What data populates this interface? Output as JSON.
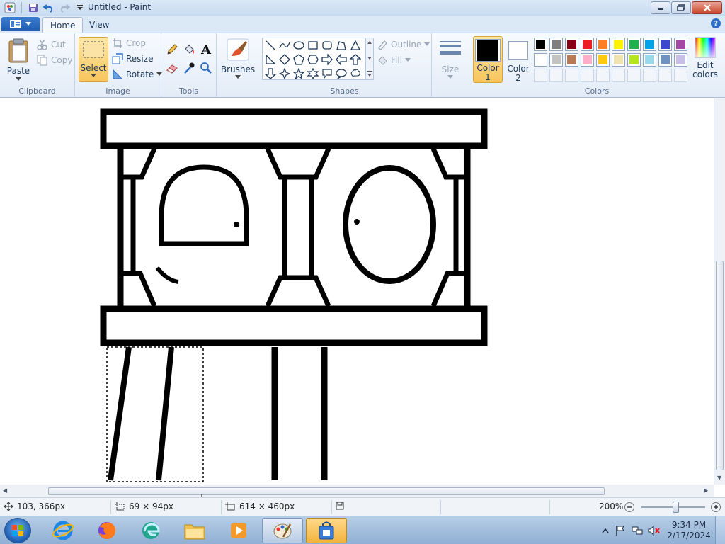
{
  "window": {
    "title": "Untitled - Paint"
  },
  "tabs": [
    {
      "label": "Home",
      "active": true
    },
    {
      "label": "View",
      "active": false
    }
  ],
  "ribbon": {
    "clipboard": {
      "label": "Clipboard",
      "paste": "Paste",
      "cut": "Cut",
      "copy": "Copy"
    },
    "image": {
      "label": "Image",
      "select": "Select",
      "crop": "Crop",
      "resize": "Resize",
      "rotate": "Rotate"
    },
    "tools": {
      "label": "Tools",
      "text_glyph": "A"
    },
    "brushes": {
      "label": "Brushes"
    },
    "shapes": {
      "label": "Shapes",
      "outline": "Outline",
      "fill": "Fill"
    },
    "size": {
      "label": "Size"
    },
    "colors": {
      "label": "Colors",
      "color1": "Color\n1",
      "color2": "Color\n2",
      "color1_value": "#000000",
      "color2_value": "#ffffff",
      "edit": "Edit\ncolors",
      "palette_row1": [
        "#000000",
        "#7f7f7f",
        "#880015",
        "#ed1c24",
        "#ff7f27",
        "#fff200",
        "#22b14c",
        "#00a2e8",
        "#3f48cc",
        "#a349a4"
      ],
      "palette_row2": [
        "#ffffff",
        "#c3c3c3",
        "#b97a57",
        "#ffaec9",
        "#ffc90e",
        "#efe4b0",
        "#b5e61d",
        "#99d9ea",
        "#7092be",
        "#c8bfe7"
      ]
    }
  },
  "status": {
    "cursor_pos": "103, 366px",
    "selection_size": "69 × 94px",
    "image_size": "614 × 460px",
    "zoom": "200%"
  },
  "taskbar": {
    "time": "9:34 PM",
    "date": "2/17/2024",
    "apps": [
      "Internet Explorer",
      "Firefox",
      "Edge",
      "File Explorer",
      "Media Player",
      "Paint",
      "Store"
    ]
  }
}
